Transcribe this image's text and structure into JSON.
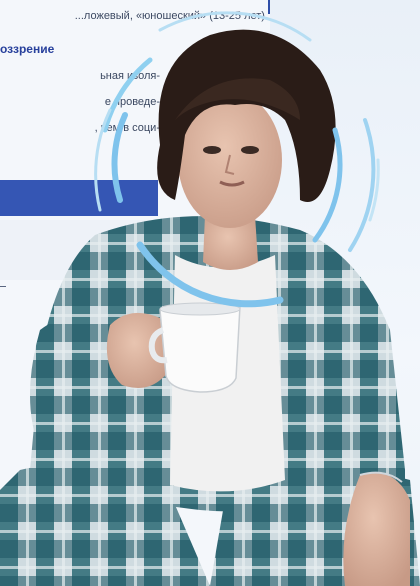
{
  "text": {
    "intro": "...ложевый,   «юношеский»  (13-25 лет).",
    "heading": "оззрение",
    "para": [
      "ьная  изоля-",
      "е  проведе-",
      ", чем в соци-"
    ]
  },
  "colors": {
    "accent": "#27409c",
    "banner": "#3556b4",
    "ring": "#7fc3ec"
  }
}
